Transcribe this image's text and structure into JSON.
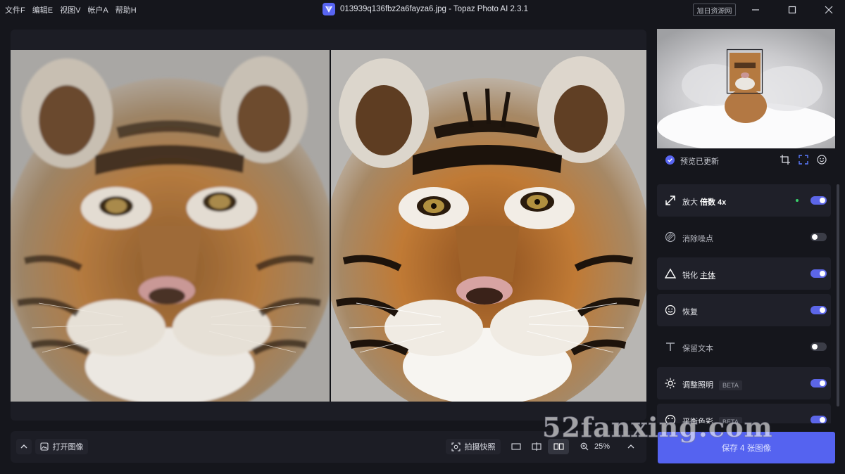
{
  "menu": [
    "文件F",
    "编辑E",
    "视图V",
    "帐户A",
    "帮助H"
  ],
  "window": {
    "title": "013939q136fbz2a6fayza6.jpg - Topaz Photo AI 2.3.1",
    "brand_badge": "旭日资源网"
  },
  "preview": {
    "status": "预览已更新"
  },
  "features": [
    {
      "label": "放大",
      "value": "倍数 4x",
      "icon": "upscale-arrow-icon",
      "enabled": true,
      "badge": ""
    },
    {
      "label": "消除噪点",
      "value": "",
      "icon": "denoise-icon",
      "enabled": false,
      "badge": ""
    },
    {
      "label": "锐化",
      "value": "主体",
      "icon": "sharpen-triangle-icon",
      "enabled": true,
      "badge": ""
    },
    {
      "label": "恢复",
      "value": "",
      "icon": "face-icon",
      "enabled": true,
      "badge": ""
    },
    {
      "label": "保留文本",
      "value": "",
      "icon": "text-icon",
      "enabled": false,
      "badge": ""
    },
    {
      "label": "调整照明",
      "value": "",
      "icon": "sun-icon",
      "enabled": true,
      "badge": "BETA"
    },
    {
      "label": "平衡色彩",
      "value": "",
      "icon": "balance-icon",
      "enabled": true,
      "badge": "BETA"
    }
  ],
  "toolbar": {
    "open_image": "打开图像",
    "snapshot": "拍摄快照",
    "zoom": "25%"
  },
  "save_button": "保存 4 张图像",
  "watermark": "52fanxing.com",
  "colors": {
    "accent": "#5865f2",
    "background": "#15161c",
    "panel": "#1c1d25",
    "active_dot": "#3ad16b"
  }
}
